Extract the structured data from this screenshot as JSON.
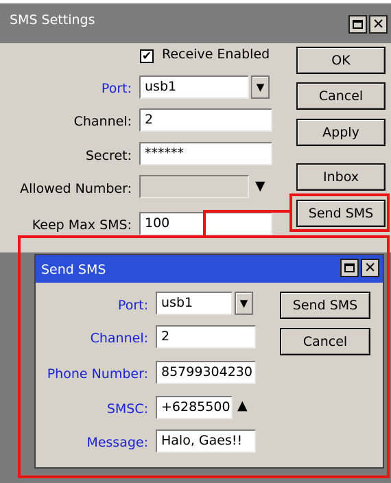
{
  "sms_settings": {
    "title": "SMS Settings",
    "receive_enabled": {
      "label": "Receive Enabled",
      "checked": true
    },
    "port": {
      "label": "Port:",
      "value": "usb1"
    },
    "channel": {
      "label": "Channel:",
      "value": "2"
    },
    "secret": {
      "label": "Secret:",
      "value": "******"
    },
    "allowed_number": {
      "label": "Allowed Number:",
      "value": ""
    },
    "keep_max_sms": {
      "label": "Keep Max SMS:",
      "value": "100"
    },
    "buttons": {
      "ok": "OK",
      "cancel": "Cancel",
      "apply": "Apply",
      "inbox": "Inbox",
      "send_sms": "Send SMS"
    }
  },
  "send_sms": {
    "title": "Send SMS",
    "port": {
      "label": "Port:",
      "value": "usb1"
    },
    "channel": {
      "label": "Channel:",
      "value": "2"
    },
    "phone_number": {
      "label": "Phone Number:",
      "value": "85799304230"
    },
    "smsc": {
      "label": "SMSC:",
      "value": "+6285500"
    },
    "message": {
      "label": "Message:",
      "value": "Halo, Gaes!!"
    },
    "buttons": {
      "send_sms": "Send SMS",
      "cancel": "Cancel"
    }
  },
  "colors": {
    "highlight": "#ea1616",
    "dialog_titlebar": "#2b4fd8",
    "label_blue": "#1a22d6"
  }
}
